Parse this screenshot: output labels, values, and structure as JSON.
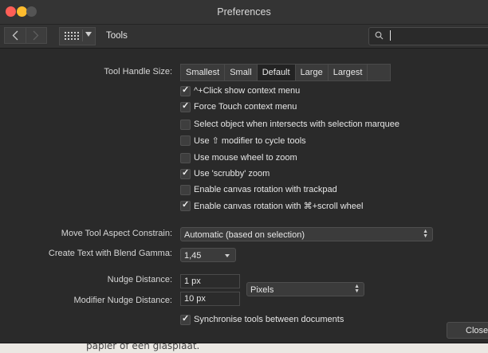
{
  "window": {
    "title": "Preferences",
    "traffic_lights": {
      "close": "#fe5f57",
      "minimize": "#febc2e",
      "zoom": "#545454"
    }
  },
  "toolbar": {
    "back_icon": "chevron-left-icon",
    "forward_icon": "chevron-right-icon",
    "grid_icon": "grid-icon",
    "breadcrumb": "Tools",
    "search": {
      "value": "",
      "placeholder": "",
      "icon": "search-icon"
    }
  },
  "tool_handle": {
    "label": "Tool Handle Size:",
    "options": [
      "Smallest",
      "Small",
      "Default",
      "Large",
      "Largest"
    ],
    "selected": "Default"
  },
  "checkboxes": [
    {
      "label": "^+Click show context menu",
      "checked": true
    },
    {
      "label": "Force Touch context menu",
      "checked": true
    },
    {
      "label": "Select object when intersects with selection marquee",
      "checked": false
    },
    {
      "label": "Use ⇧ modifier to cycle tools",
      "checked": false
    },
    {
      "label": "Use mouse wheel to zoom",
      "checked": false
    },
    {
      "label": "Use 'scrubby' zoom",
      "checked": true
    },
    {
      "label": "Enable canvas rotation with trackpad",
      "checked": false
    },
    {
      "label": "Enable canvas rotation with ⌘+scroll wheel",
      "checked": true
    }
  ],
  "move_tool": {
    "label": "Move Tool Aspect Constrain:",
    "value": "Automatic (based on selection)"
  },
  "blend_gamma": {
    "label": "Create Text with Blend Gamma:",
    "value": "1,45"
  },
  "nudge": {
    "label": "Nudge Distance:",
    "value": "1 px"
  },
  "modifier_nudge": {
    "label": "Modifier Nudge Distance:",
    "value": "10 px"
  },
  "units": {
    "value": "Pixels"
  },
  "sync": {
    "label": "Synchronise tools between documents",
    "checked": true
  },
  "close_button": {
    "label": "Close"
  },
  "background_text": "papier of een glasplaat."
}
